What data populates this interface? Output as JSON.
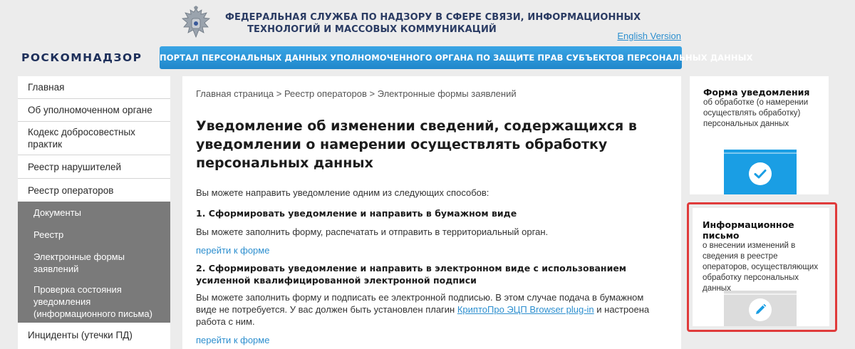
{
  "header": {
    "agency_line1": "ФЕДЕРАЛЬНАЯ СЛУЖБА ПО НАДЗОРУ В СФЕРЕ СВЯЗИ, ИНФОРМАЦИОННЫХ",
    "agency_line2": "ТЕХНОЛОГИЙ И МАССОВЫХ КОММУНИКАЦИЙ",
    "english_link": "English Version",
    "logo_text": "РОСКОМНАДЗОР",
    "portal_title": "ПОРТАЛ ПЕРСОНАЛЬНЫХ ДАННЫХ УПОЛНОМОЧЕННОГО ОРГАНА ПО ЗАЩИТЕ ПРАВ СУБЪЕКТОВ ПЕРСОНАЛЬНЫХ ДАННЫХ"
  },
  "sidebar": {
    "items": [
      {
        "label": "Главная"
      },
      {
        "label": "Об уполномоченном органе"
      },
      {
        "label": "Кодекс добросовестных практик"
      },
      {
        "label": "Реестр нарушителей"
      },
      {
        "label": "Реестр операторов"
      }
    ],
    "subitems": [
      {
        "label": "Документы"
      },
      {
        "label": "Реестр"
      },
      {
        "label": "Электронные формы заявлений"
      },
      {
        "label": "Проверка состояния уведомления (информационного письма)"
      }
    ],
    "after": [
      {
        "label": "Инциденты (утечки ПД)"
      }
    ]
  },
  "main": {
    "breadcrumb": "Главная страница > Реестр операторов > Электронные формы заявлений",
    "title": "Уведомление об изменении сведений, содержащихся в уведомлении о намерении осуществлять обработку персональных данных",
    "intro": "Вы можете направить уведомление одним из следующих способов:",
    "option1_title": "1. Сформировать уведомление и направить в бумажном виде",
    "option1_text": "Вы можете заполнить форму, распечатать и отправить в территориальный орган.",
    "option1_link": "перейти к форме",
    "option2_title": "2. Сформировать уведомление и направить в электронном виде с использованием усиленной квалифицированной электронной подписи",
    "option2_text_before": "Вы можете заполнить форму и подписать ее электронной подписью. В этом случае подача в бумажном виде не потребуется. У вас должен быть установлен плагин ",
    "option2_plugin_link": "КриптоПро ЭЦП Browser plug-in",
    "option2_text_after": " и настроена работа с ним.",
    "option2_link": "перейти к форме"
  },
  "cards": {
    "card1_title": "Форма уведомления",
    "card1_desc": "об обработке (о намерении осуществлять обработку) персональных данных",
    "card2_title": "Информационное письмо",
    "card2_desc": "о внесении изменений в сведения в реестре операторов, осуществляющих обработку персональных данных"
  },
  "colors": {
    "accent_blue": "#2087cb",
    "link_blue": "#2d8fcf",
    "highlight_red": "#e03b3b",
    "sidebar_active_bg": "#7a7a7a"
  }
}
